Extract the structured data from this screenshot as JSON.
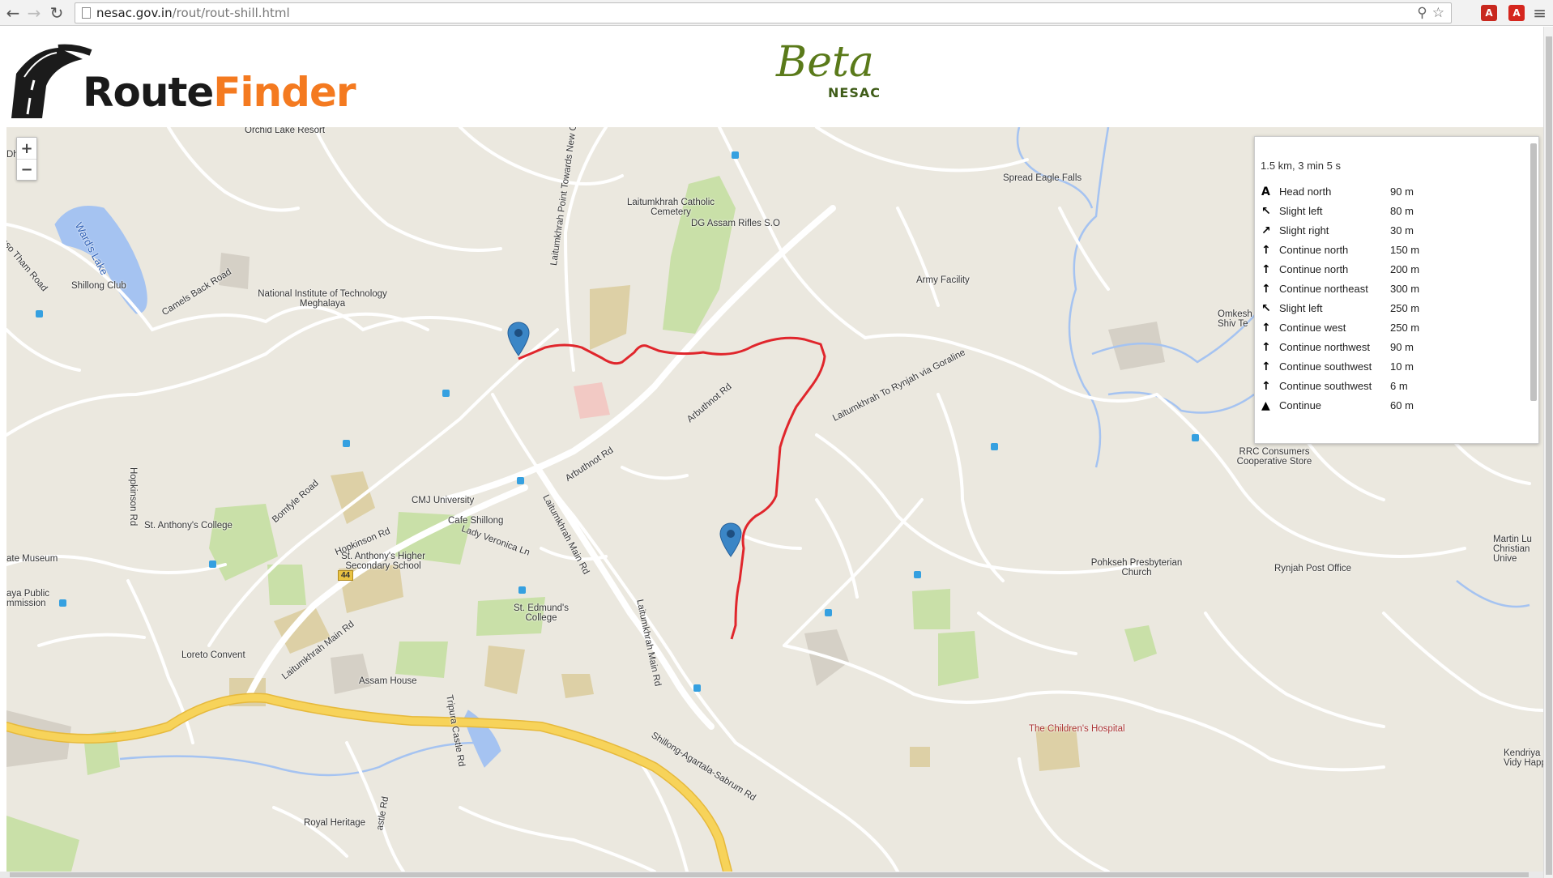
{
  "browser": {
    "url_host": "nesac.gov.in",
    "url_path": "/rout/rout-shill.html",
    "back_icon": "arrow-left",
    "forward_icon": "arrow-right",
    "reload_icon": "reload",
    "zoom_icon": "magnifier",
    "bookmark_icon": "star",
    "menu_icon": "hamburger"
  },
  "header": {
    "logo_word1": "Route",
    "logo_word2": "Finder",
    "beta": "Beta",
    "nesac": "NESAC"
  },
  "map": {
    "zoom_in": "+",
    "zoom_out": "−",
    "highway_shield": "44",
    "labels": {
      "orchid": "Orchid Lake Resort",
      "dhaba": "Dhaba",
      "wards_lake": "Ward's Lake",
      "shillong_club": "Shillong Club",
      "camels_back": "Camels Back Road",
      "nit": "National Institute of Technology Meghalaya",
      "cemetery": "Laitumkhrah Catholic Cemetery",
      "assam_rifles": "DG Assam Rifles S.O",
      "laitumkhrah_point": "Laitumkhrah Point Towards New C",
      "spread_eagle": "Spread Eagle Falls",
      "army": "Army Facility",
      "omkesh": "Omkesh Shiv Te",
      "rrc": "RRC Consumers Cooperative Store",
      "arbuthnot1": "Arbuthnot Rd",
      "arbuthnot2": "Arbuthnot Rd",
      "ryn_road": "Laitumkhrah To Rynjah via Goraline",
      "cmj": "CMJ University",
      "cafe": "Cafe Shillong",
      "lady_veronica": "Lady Veronica Ln",
      "laitumkhrah_main": "Laitumkhrah Main Rd",
      "laitumkhrah_main2": "Laitumkhrah Main Rd",
      "laitumkhrah_main3": "Laitumkhrah Main Rd",
      "bomfyle": "Bomfyle Road",
      "hopkinson1": "Hopkinson Rd",
      "hopkinson2": "Hopkinson Rd",
      "st_anthonys": "St. Anthony's College",
      "st_anthonys_school": "St. Anthony's Higher Secondary School",
      "museum": "ate Museum",
      "public": "aya Public mmission",
      "st_edmunds": "St. Edmund's College",
      "loreto": "Loreto Convent",
      "assam_house": "Assam House",
      "tripura": "Tripura Castle Rd",
      "castle_rd": "astle Rd",
      "royal": "Royal Heritage",
      "nh": "Shillong-Agartala-Sabrum Rd",
      "childrens": "The Children's Hospital",
      "pohkseh": "Pohkseh Presbyterian Church",
      "rynjah_post": "Rynjah Post Office",
      "martin": "Martin Lu Christian Unive",
      "kendriya": "Kendriya Vidy Happy",
      "oso_tham": "oso Tham Road"
    }
  },
  "directions": {
    "summary": "1.5 km, 3 min 5 s",
    "steps": [
      {
        "icon": "A",
        "icon_name": "start-marker-icon",
        "instruction": "Head north",
        "distance": "90 m"
      },
      {
        "icon": "↖",
        "icon_name": "slight-left-icon",
        "instruction": "Slight left",
        "distance": "80 m"
      },
      {
        "icon": "↗",
        "icon_name": "slight-right-icon",
        "instruction": "Slight right",
        "distance": "30 m"
      },
      {
        "icon": "↑",
        "icon_name": "straight-icon",
        "instruction": "Continue north",
        "distance": "150 m"
      },
      {
        "icon": "↑",
        "icon_name": "straight-icon",
        "instruction": "Continue north",
        "distance": "200 m"
      },
      {
        "icon": "↑",
        "icon_name": "straight-icon",
        "instruction": "Continue northeast",
        "distance": "300 m"
      },
      {
        "icon": "↖",
        "icon_name": "slight-left-icon",
        "instruction": "Slight left",
        "distance": "250 m"
      },
      {
        "icon": "↑",
        "icon_name": "straight-icon",
        "instruction": "Continue west",
        "distance": "250 m"
      },
      {
        "icon": "↑",
        "icon_name": "straight-icon",
        "instruction": "Continue northwest",
        "distance": "90 m"
      },
      {
        "icon": "↑",
        "icon_name": "straight-icon",
        "instruction": "Continue southwest",
        "distance": "10 m"
      },
      {
        "icon": "↑",
        "icon_name": "straight-icon",
        "instruction": "Continue southwest",
        "distance": "6 m"
      },
      {
        "icon": "▲",
        "icon_name": "straight-icon",
        "instruction": "Continue",
        "distance": "60 m"
      }
    ]
  },
  "colors": {
    "route": "#e0262c",
    "highway": "#f7d35a",
    "water": "#a5c3f1",
    "park": "#c9e0a8",
    "marker": "#3b86c6"
  }
}
